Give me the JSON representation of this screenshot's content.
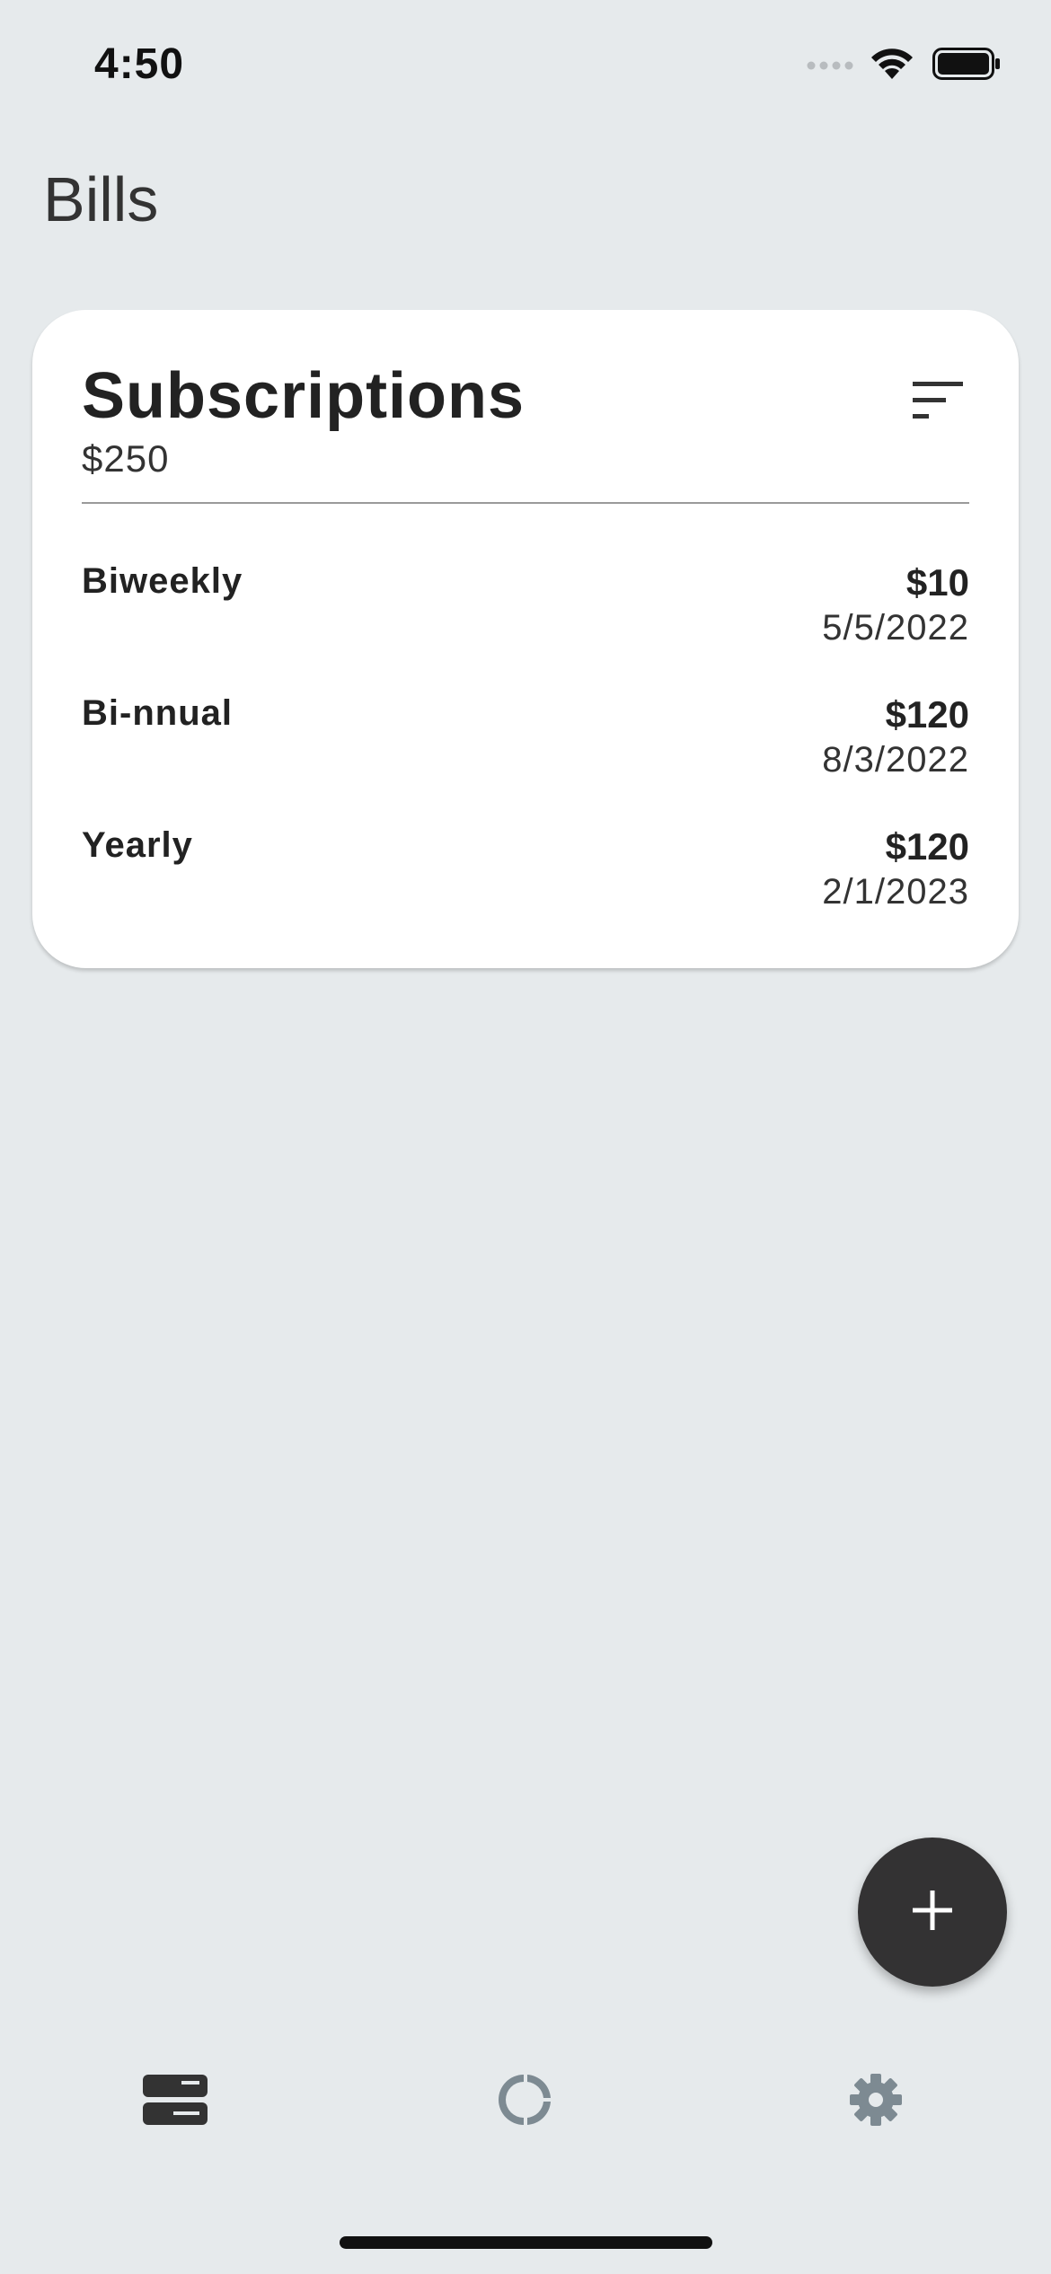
{
  "status_bar": {
    "time": "4:50",
    "icons": [
      "cellular-signal-icon",
      "wifi-icon",
      "battery-icon"
    ]
  },
  "page": {
    "title": "Bills"
  },
  "card": {
    "title": "Subscriptions",
    "total": "$250",
    "sort_icon": "sort-icon",
    "bills": [
      {
        "name": "Biweekly",
        "amount": "$10",
        "date": "5/5/2022"
      },
      {
        "name": "Bi-nnual",
        "amount": "$120",
        "date": "8/3/2022"
      },
      {
        "name": "Yearly",
        "amount": "$120",
        "date": "2/1/2023"
      }
    ]
  },
  "fab": {
    "icon": "plus-icon"
  },
  "bottom_nav": {
    "items": [
      {
        "icon": "bills-icon",
        "active": true
      },
      {
        "icon": "budget-ring-icon",
        "active": false
      },
      {
        "icon": "gear-icon",
        "active": false
      }
    ]
  },
  "colors": {
    "background": "#e6eaec",
    "card": "#ffffff",
    "fab": "#333233",
    "active_icon": "#333333",
    "inactive_icon": "#7d8a92"
  }
}
